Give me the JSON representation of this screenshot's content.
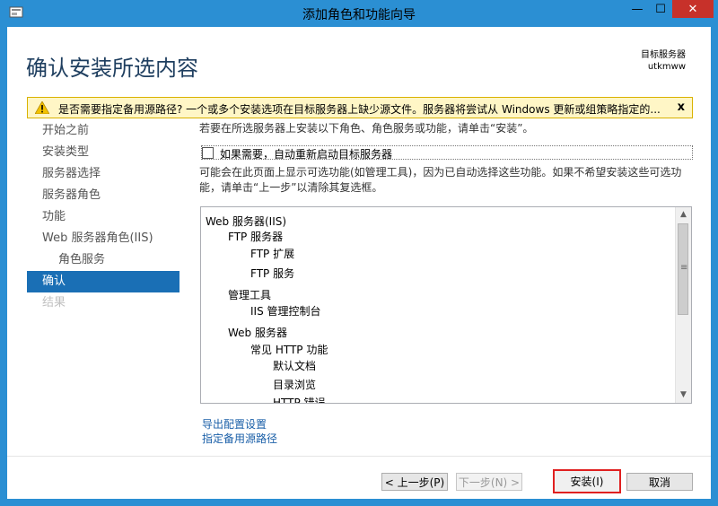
{
  "window": {
    "title": "添加角色和功能向导",
    "controls": {
      "minimize": "—",
      "maximize": "☐",
      "close": "✕"
    }
  },
  "header": {
    "page_title": "确认安装所选内容",
    "server_caption": "目标服务器",
    "server_name": "utkmww"
  },
  "warning": {
    "text": "是否需要指定备用源路径? 一个或多个安装选项在目标服务器上缺少源文件。服务器将尝试从 Windows 更新或组策略指定的...",
    "close": "x"
  },
  "nav": {
    "items": [
      {
        "label": "开始之前",
        "state": "normal"
      },
      {
        "label": "安装类型",
        "state": "normal"
      },
      {
        "label": "服务器选择",
        "state": "normal"
      },
      {
        "label": "服务器角色",
        "state": "normal"
      },
      {
        "label": "功能",
        "state": "normal"
      },
      {
        "label": "Web 服务器角色(IIS)",
        "state": "normal"
      },
      {
        "label": "角色服务",
        "state": "normal"
      },
      {
        "label": "确认",
        "state": "active"
      },
      {
        "label": "结果",
        "state": "disabled"
      }
    ]
  },
  "content": {
    "intro": "若要在所选服务器上安装以下角色、角色服务或功能，请单击“安装”。",
    "restart_label": "如果需要，自动重新启动目标服务器",
    "restart_checked": false,
    "note": "可能会在此页面上显示可选功能(如管理工具)，因为已自动选择这些功能。如果不希望安装这些可选功能，请单击“上一步”以清除其复选框。",
    "tree": [
      {
        "label": "Web 服务器(IIS)",
        "level": 0
      },
      {
        "label": "FTP 服务器",
        "level": 1
      },
      {
        "label": "FTP 扩展",
        "level": 2
      },
      {
        "label": "FTP 服务",
        "level": 2
      },
      {
        "label": "管理工具",
        "level": 1
      },
      {
        "label": "IIS 管理控制台",
        "level": 2
      },
      {
        "label": "Web 服务器",
        "level": 1
      },
      {
        "label": "常见 HTTP 功能",
        "level": 2
      },
      {
        "label": "默认文档",
        "level": 3
      },
      {
        "label": "目录浏览",
        "level": 3
      },
      {
        "label": "HTTP 错误",
        "level": 3
      }
    ],
    "links": {
      "export": "导出配置设置",
      "alt_source": "指定备用源路径"
    }
  },
  "buttons": {
    "prev": "< 上一步(P)",
    "next": "下一步(N) >",
    "install": "安装(I)",
    "cancel": "取消"
  },
  "colors": {
    "accent": "#1a6fb5",
    "titlebar": "#2b8fd3",
    "close": "#c7312a",
    "warning_bg": "#fff6c6",
    "highlight_border": "#e02020"
  }
}
